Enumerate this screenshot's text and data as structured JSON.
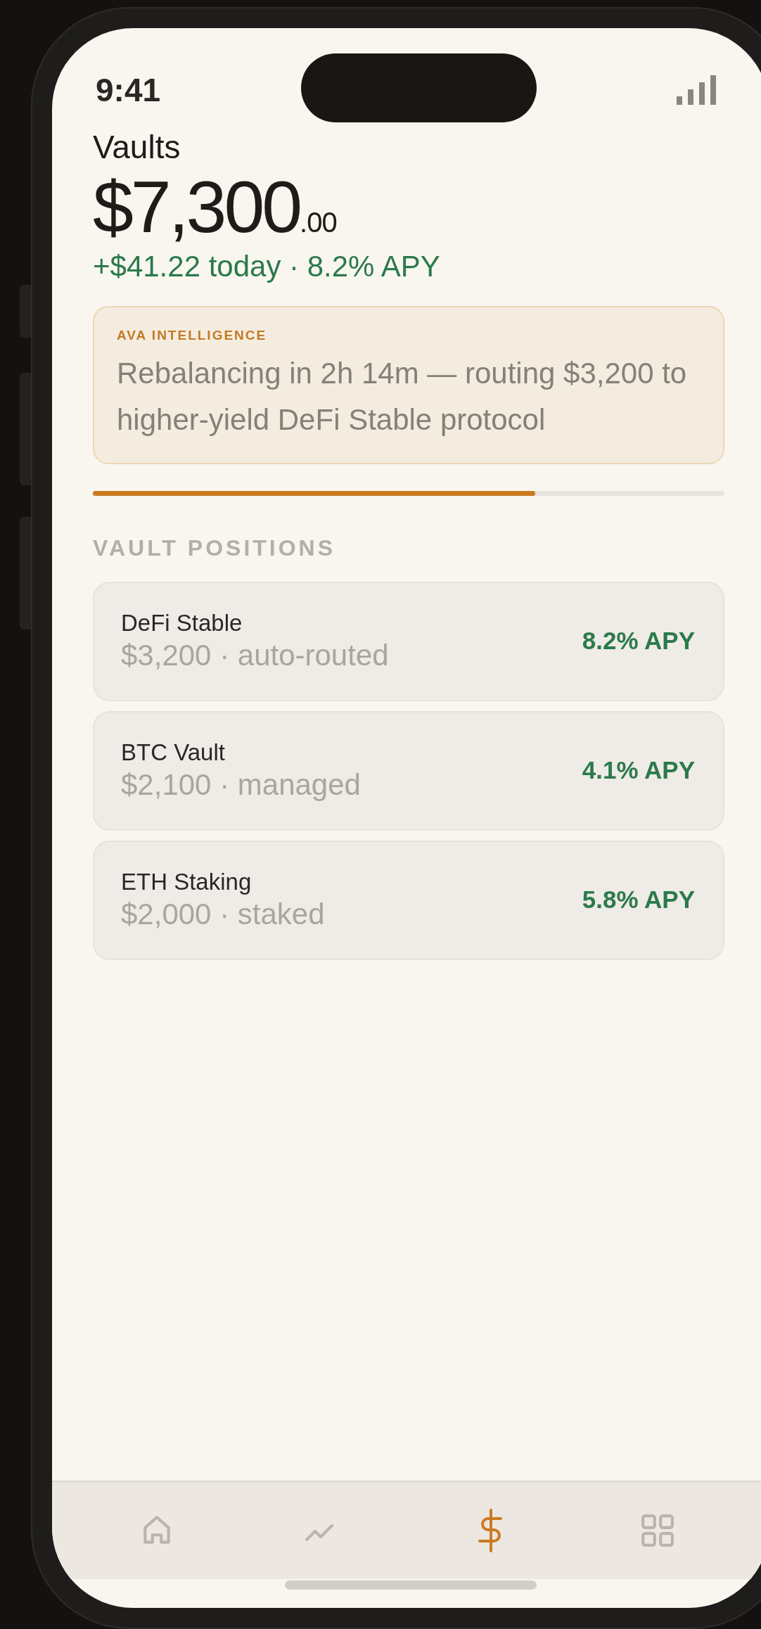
{
  "status_bar": {
    "time": "9:41"
  },
  "header": {
    "title": "Vaults",
    "balance": {
      "whole": "$7,300",
      "cents": ".00"
    },
    "change": "+$41.22 today · 8.2% APY"
  },
  "insight": {
    "label": "AVA INTELLIGENCE",
    "text": "Rebalancing in 2h 14m — routing $3,200 to higher-yield DeFi Stable protocol"
  },
  "progress": {
    "level": 0.7
  },
  "positions": {
    "heading": "VAULT POSITIONS",
    "items": [
      {
        "name": "DeFi Stable",
        "detail": "$3,200 · auto-routed",
        "apy": "8.2% APY"
      },
      {
        "name": "BTC Vault",
        "detail": "$2,100 · managed",
        "apy": "4.1% APY"
      },
      {
        "name": "ETH Staking",
        "detail": "$2,000 · staked",
        "apy": "5.8% APY"
      }
    ]
  },
  "nav": [
    {
      "kind": "home",
      "selected": false
    },
    {
      "kind": "chart",
      "selected": false
    },
    {
      "kind": "dollar",
      "selected": true
    },
    {
      "kind": "grid",
      "selected": false
    }
  ]
}
